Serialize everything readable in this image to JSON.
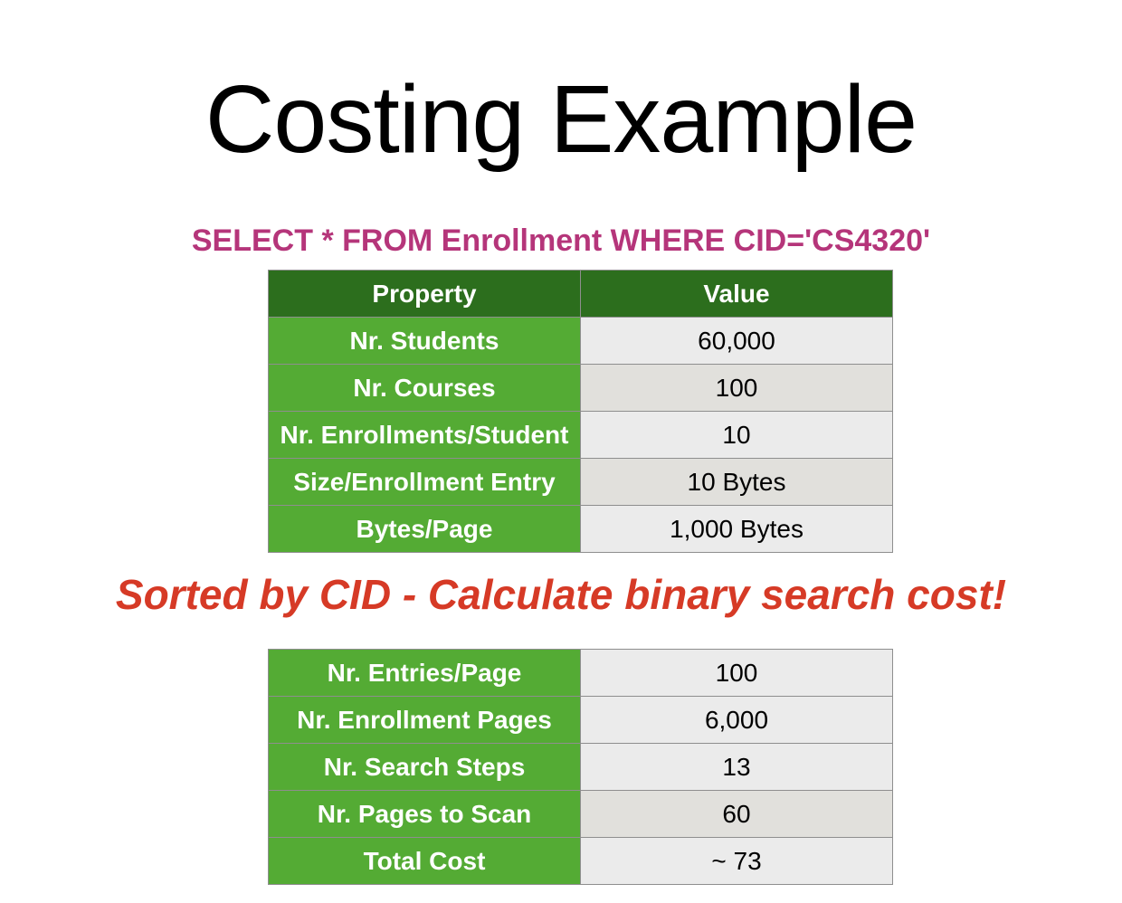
{
  "slide": {
    "title": "Costing Example",
    "query": "SELECT * FROM Enrollment WHERE CID='CS4320'",
    "note": "Sorted by CID - Calculate binary search cost!"
  },
  "colors": {
    "title": "#000000",
    "query": "#b5357a",
    "note": "#d63a26",
    "header_bg": "#2c6e1d",
    "property_bg": "#54ab34",
    "value_bg_light": "#ebebeb",
    "value_bg_dark": "#e1e0dc"
  },
  "table1": {
    "headers": [
      "Property",
      "Value"
    ],
    "rows": [
      {
        "property": "Nr. Students",
        "value": "60,000"
      },
      {
        "property": "Nr. Courses",
        "value": "100"
      },
      {
        "property": "Nr. Enrollments/Student",
        "value": "10"
      },
      {
        "property": "Size/Enrollment Entry",
        "value": "10 Bytes"
      },
      {
        "property": "Bytes/Page",
        "value": "1,000 Bytes"
      }
    ]
  },
  "table2": {
    "rows": [
      {
        "property": "Nr. Entries/Page",
        "value": "100"
      },
      {
        "property": "Nr. Enrollment Pages",
        "value": "6,000"
      },
      {
        "property": "Nr. Search Steps",
        "value": "13"
      },
      {
        "property": "Nr. Pages to Scan",
        "value": "60"
      },
      {
        "property": "Total Cost",
        "value": "~ 73"
      }
    ]
  }
}
